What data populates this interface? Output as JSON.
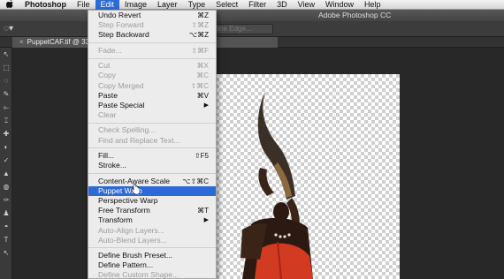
{
  "menubar": {
    "apple": "",
    "items": [
      "Photoshop",
      "File",
      "Edit",
      "Image",
      "Layer",
      "Type",
      "Select",
      "Filter",
      "3D",
      "View",
      "Window",
      "Help"
    ],
    "active_index": 2
  },
  "window": {
    "title": "Adobe Photoshop CC"
  },
  "options_bar": {
    "refine_edge": "fine Edge..."
  },
  "document_tab": {
    "close_glyph": "×",
    "label": "PuppetCAF.tif @ 33.3% (RGB/8*)"
  },
  "tools": [
    "↖",
    "⬚",
    "◌",
    "✎",
    "⟜",
    "⌶",
    "✚",
    "◐",
    "✓",
    "▲",
    "◍",
    "✑",
    "♟",
    "◓",
    "T",
    "↖"
  ],
  "edit_menu": {
    "groups": [
      [
        {
          "label": "Undo Revert",
          "shortcut": "⌘Z",
          "enabled": true
        },
        {
          "label": "Step Forward",
          "shortcut": "⇧⌘Z",
          "enabled": false
        },
        {
          "label": "Step Backward",
          "shortcut": "⌥⌘Z",
          "enabled": true
        }
      ],
      [
        {
          "label": "Fade...",
          "shortcut": "⇧⌘F",
          "enabled": false
        }
      ],
      [
        {
          "label": "Cut",
          "shortcut": "⌘X",
          "enabled": false
        },
        {
          "label": "Copy",
          "shortcut": "⌘C",
          "enabled": false
        },
        {
          "label": "Copy Merged",
          "shortcut": "⇧⌘C",
          "enabled": false
        },
        {
          "label": "Paste",
          "shortcut": "⌘V",
          "enabled": true
        },
        {
          "label": "Paste Special",
          "submenu": true,
          "enabled": true
        },
        {
          "label": "Clear",
          "enabled": false
        }
      ],
      [
        {
          "label": "Check Spelling...",
          "enabled": false
        },
        {
          "label": "Find and Replace Text...",
          "enabled": false
        }
      ],
      [
        {
          "label": "Fill...",
          "shortcut": "⇧F5",
          "enabled": true
        },
        {
          "label": "Stroke...",
          "enabled": true
        }
      ],
      [
        {
          "label": "Content-Aware Scale",
          "shortcut": "⌥⇧⌘C",
          "enabled": true
        },
        {
          "label": "Puppet Warp",
          "enabled": true,
          "highlighted": true
        },
        {
          "label": "Perspective Warp",
          "enabled": true
        },
        {
          "label": "Free Transform",
          "shortcut": "⌘T",
          "enabled": true
        },
        {
          "label": "Transform",
          "submenu": true,
          "enabled": true
        },
        {
          "label": "Auto-Align Layers...",
          "enabled": false
        },
        {
          "label": "Auto-Blend Layers...",
          "enabled": false
        }
      ],
      [
        {
          "label": "Define Brush Preset...",
          "enabled": true
        },
        {
          "label": "Define Pattern...",
          "enabled": true
        },
        {
          "label": "Define Custom Shape...",
          "enabled": false
        }
      ]
    ]
  }
}
